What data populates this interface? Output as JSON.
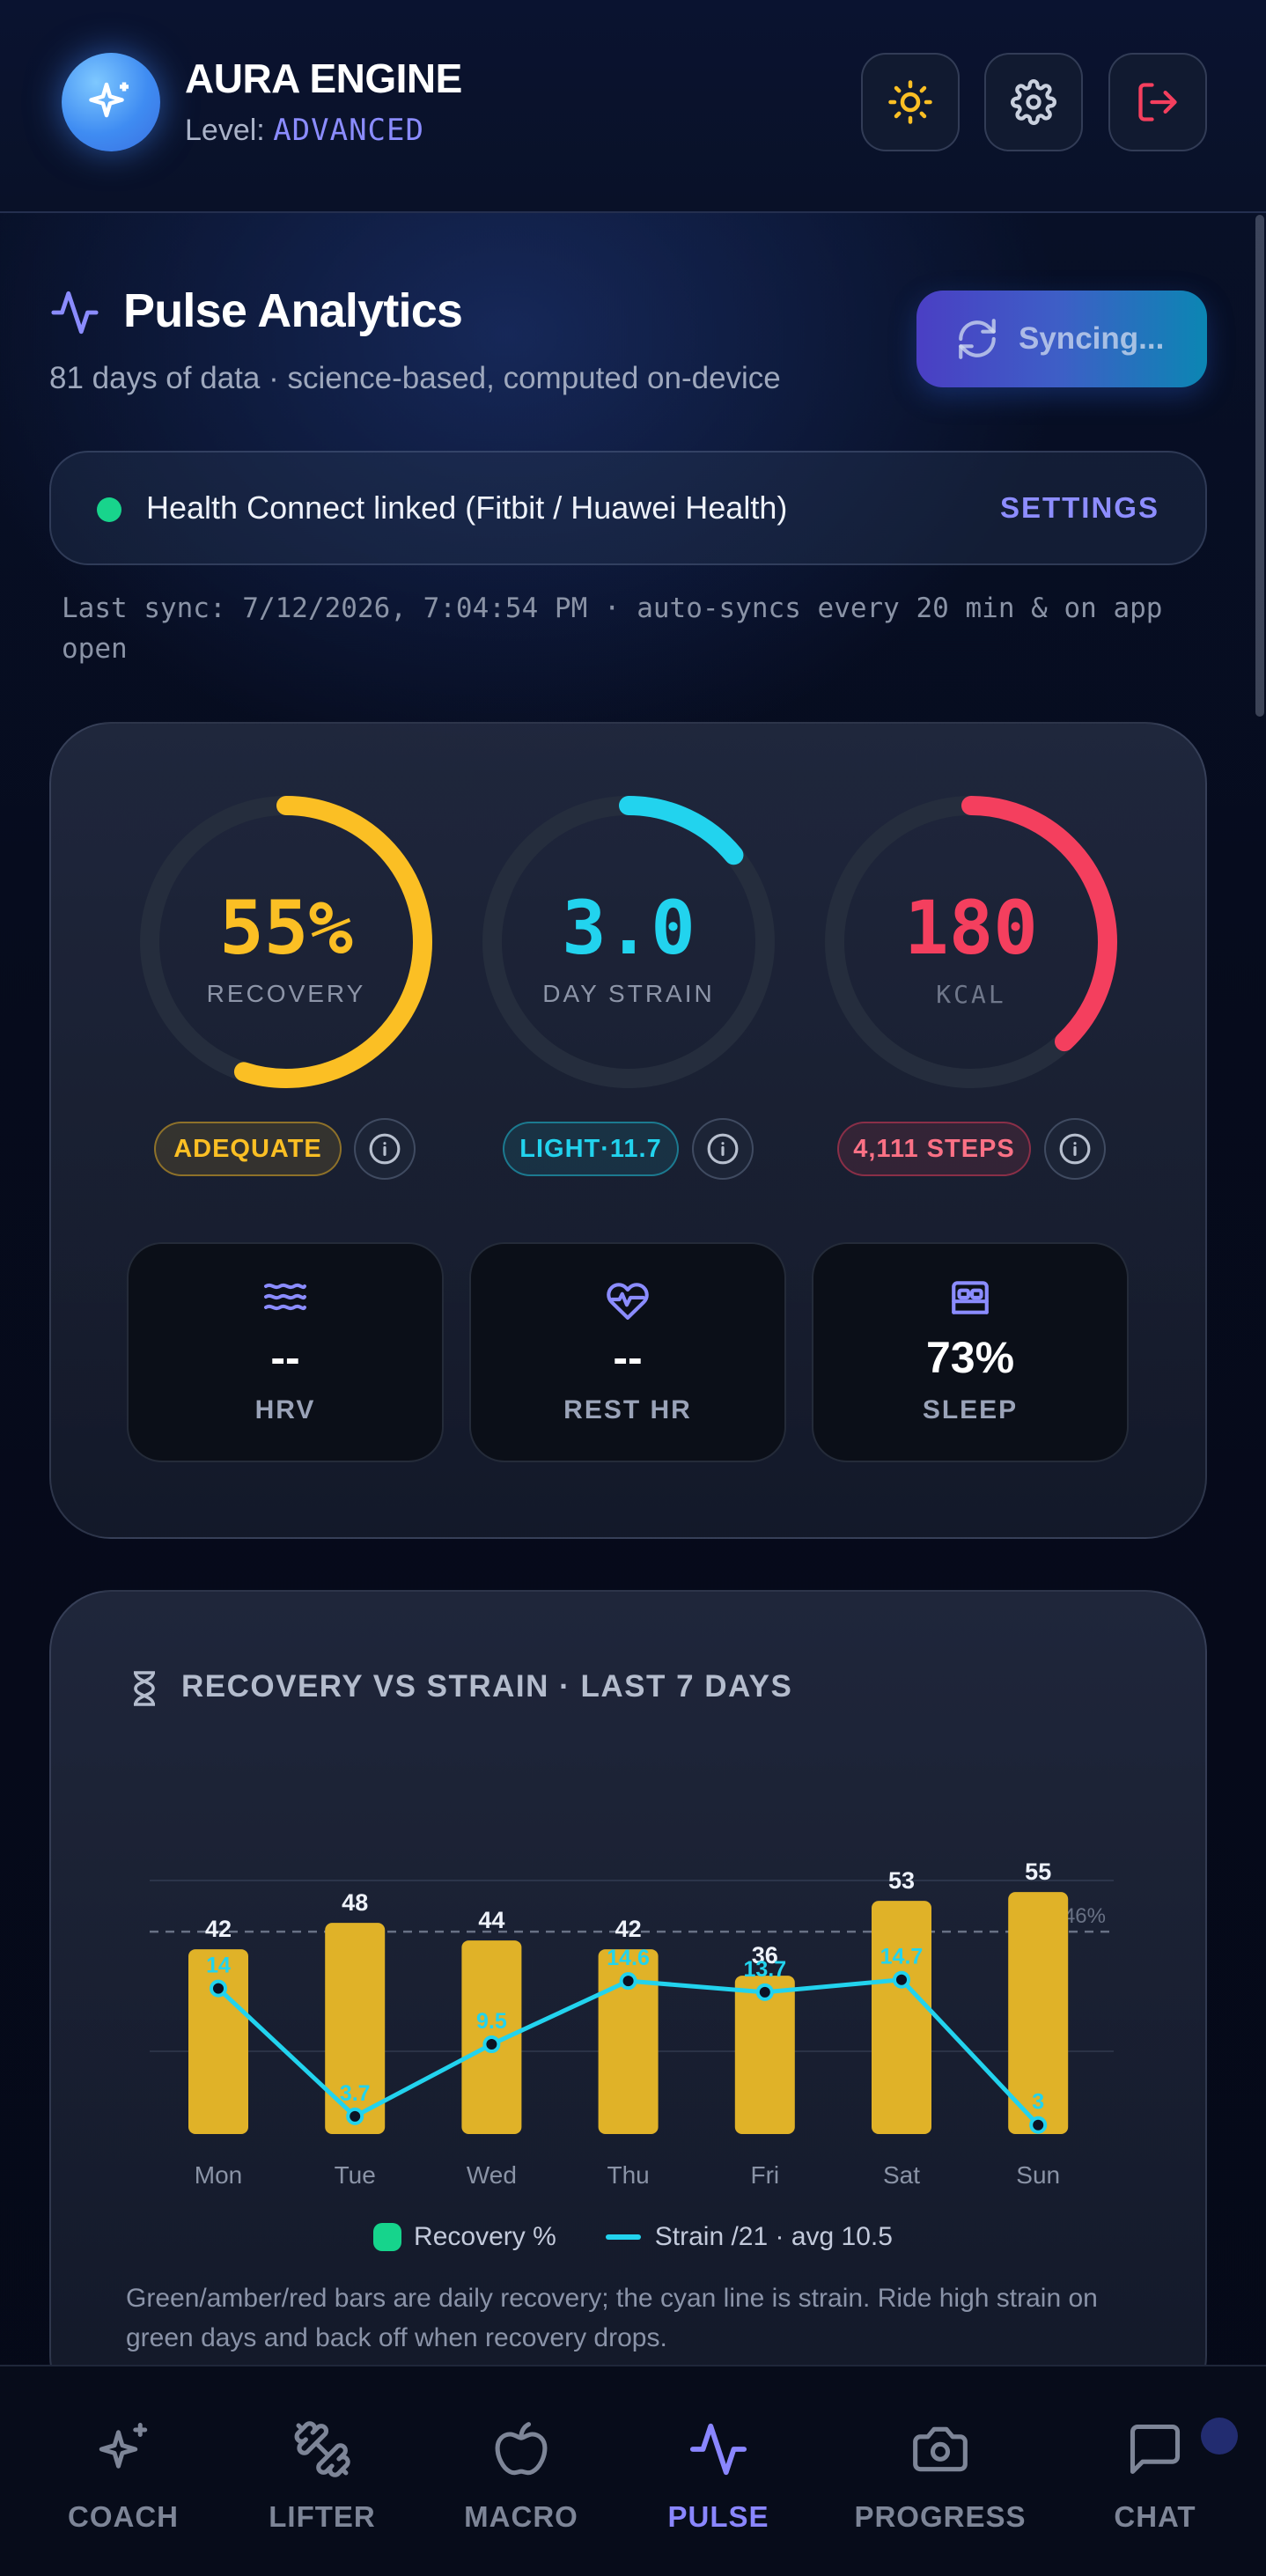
{
  "header": {
    "app_name": "AURA ENGINE",
    "level_label": "Level:",
    "level_value": "ADVANCED",
    "buttons": [
      "sun-icon",
      "gear-icon",
      "logout-icon"
    ]
  },
  "analytics": {
    "title": "Pulse Analytics",
    "subtitle": "81 days of data · science-based, computed on-device",
    "sync_button": "Syncing..."
  },
  "connection": {
    "text": "Health Connect linked (Fitbit / Huawei Health)",
    "settings": "SETTINGS",
    "status_color": "#18d48c",
    "last_sync": "Last sync: 7/12/2026, 7:04:54 PM · auto-syncs every 20 min & on app open"
  },
  "rings": [
    {
      "value": "55%",
      "label": "RECOVERY",
      "pill": "ADEQUATE",
      "color": "#fbbf24",
      "fraction": 0.55
    },
    {
      "value": "3.0",
      "label": "DAY STRAIN",
      "pill": "LIGHT·11.7",
      "color": "#22d3ee",
      "fraction": 0.14
    },
    {
      "value": "180",
      "label": "KCAL",
      "pill": "4,111 STEPS",
      "color": "#f43f5e",
      "fraction": 0.38
    }
  ],
  "metrics": [
    {
      "value": "--",
      "label": "HRV",
      "icon": "waves-icon"
    },
    {
      "value": "--",
      "label": "REST HR",
      "icon": "heart-pulse-icon"
    },
    {
      "value": "73%",
      "label": "SLEEP",
      "icon": "bed-icon"
    }
  ],
  "chart_section": {
    "title": "RECOVERY VS STRAIN · LAST 7 DAYS",
    "legend_recovery": "Recovery %",
    "legend_strain": "Strain /21 · avg 10.5",
    "caption": "Green/amber/red bars are daily recovery; the cyan line is strain. Ride high strain on green days and back off when recovery drops."
  },
  "chart_data": {
    "type": "bar",
    "categories": [
      "Mon",
      "Tue",
      "Wed",
      "Thu",
      "Fri",
      "Sat",
      "Sun"
    ],
    "series": [
      {
        "name": "Recovery %",
        "type": "bar",
        "values": [
          42,
          48,
          44,
          42,
          36,
          53,
          55
        ],
        "color": "#e0b228"
      },
      {
        "name": "Strain /21 · avg 10.5",
        "type": "line",
        "values": [
          14,
          3.7,
          9.5,
          14.6,
          13.7,
          14.7,
          3
        ],
        "color": "#22d3ee"
      }
    ],
    "avg_label": "avg 46%",
    "avg_value": 46,
    "ylim": [
      0,
      60
    ]
  },
  "nav": {
    "items": [
      {
        "label": "COACH",
        "icon": "sparkles-icon",
        "active": false
      },
      {
        "label": "LIFTER",
        "icon": "dumbbell-icon",
        "active": false
      },
      {
        "label": "MACRO",
        "icon": "apple-icon",
        "active": false
      },
      {
        "label": "PULSE",
        "icon": "activity-icon",
        "active": true
      },
      {
        "label": "PROGRESS",
        "icon": "camera-icon",
        "active": false
      },
      {
        "label": "CHAT",
        "icon": "chat-icon",
        "active": false
      }
    ]
  }
}
